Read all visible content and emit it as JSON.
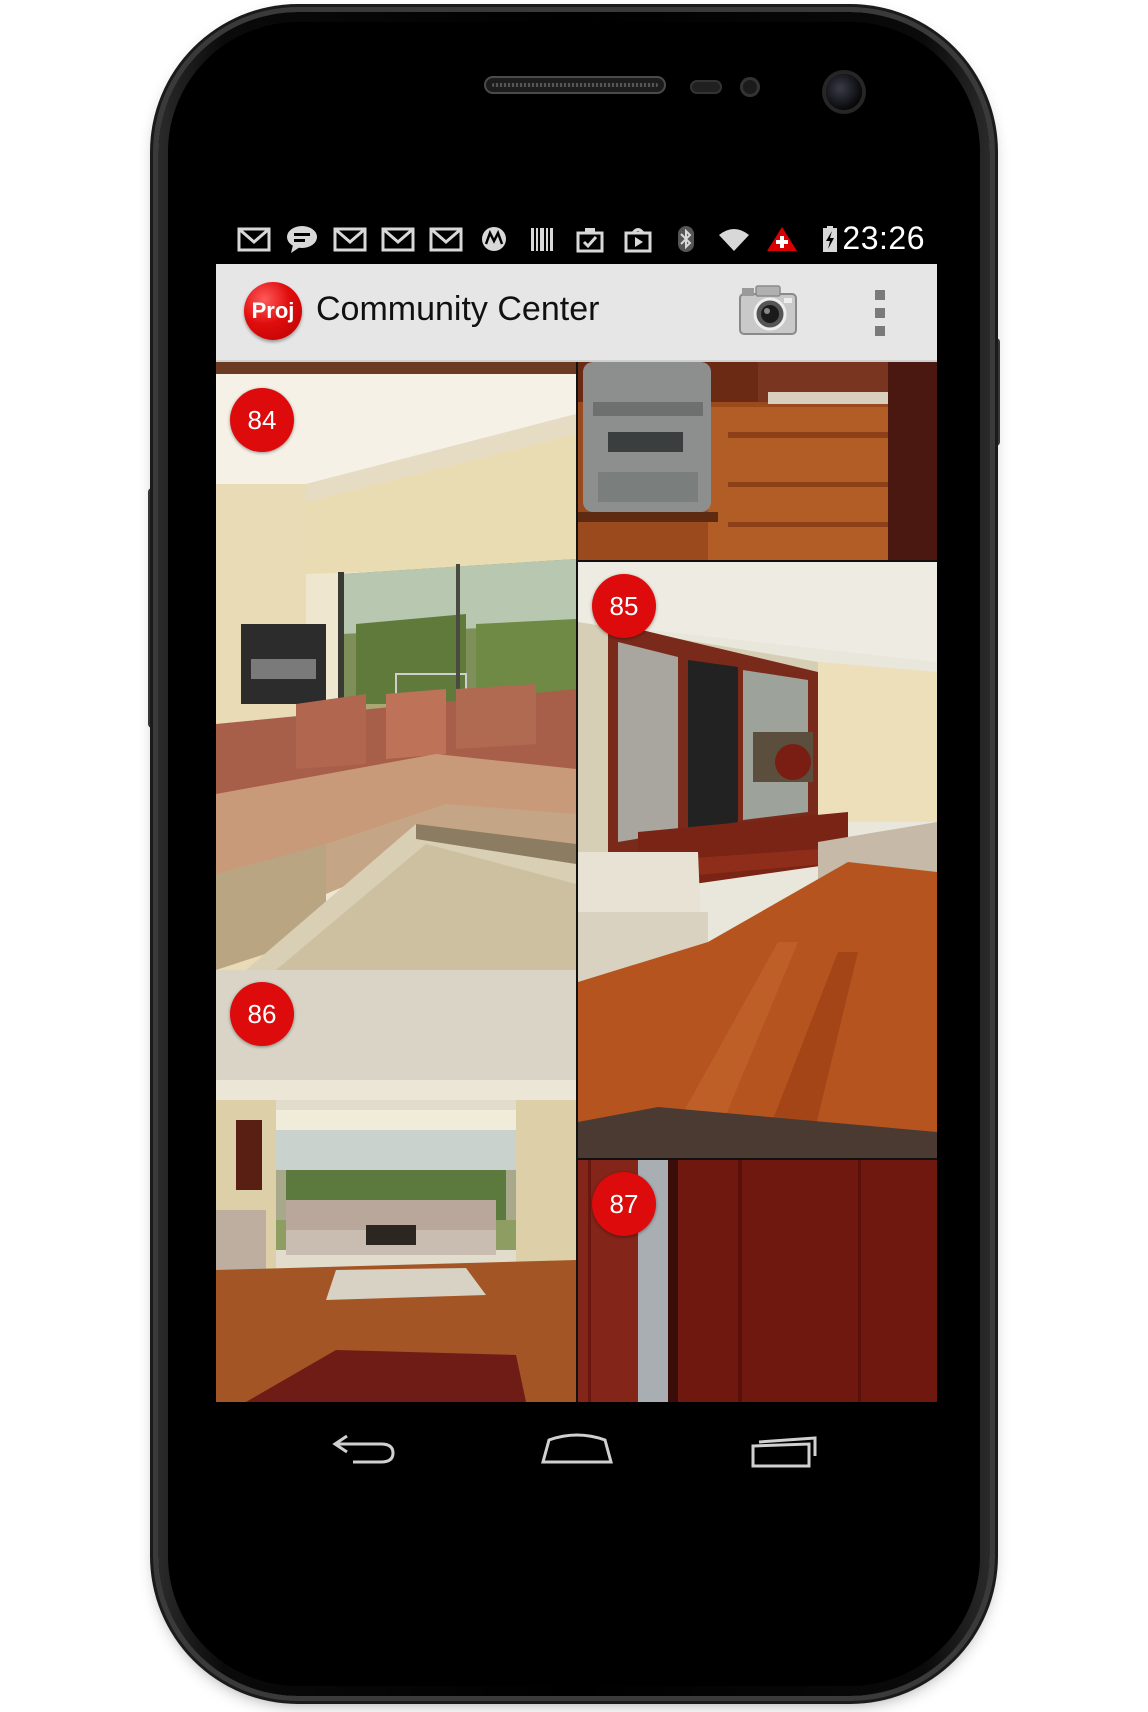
{
  "status_bar": {
    "time": "23:26",
    "icons": [
      "gmail-icon",
      "chat-icon",
      "gmail-icon",
      "gmail-icon",
      "gmail-icon",
      "motorola-icon",
      "barcode-icon",
      "clipboard-check-icon",
      "play-store-icon",
      "bluetooth-icon",
      "wifi-icon",
      "alert-icon",
      "battery-charging-icon"
    ]
  },
  "action_bar": {
    "logo_text": "Proj",
    "title": "Community Center",
    "camera_icon": "camera-icon",
    "overflow_icon": "overflow-menu-icon"
  },
  "photos": [
    {
      "number": "84",
      "subject": "living room sofa"
    },
    {
      "number": "",
      "subject": "cooler and wood floor"
    },
    {
      "number": "85",
      "subject": "living room cabinets"
    },
    {
      "number": "86",
      "subject": "lounge with window"
    },
    {
      "number": "87",
      "subject": "wood panel door"
    }
  ],
  "nav_bar": {
    "back_icon": "back-icon",
    "home_icon": "home-icon",
    "recents_icon": "recents-icon"
  },
  "colors": {
    "accent": "#dd0b0b",
    "action_bar_bg": "#e6e6e6",
    "wood": "#9a3a14"
  }
}
